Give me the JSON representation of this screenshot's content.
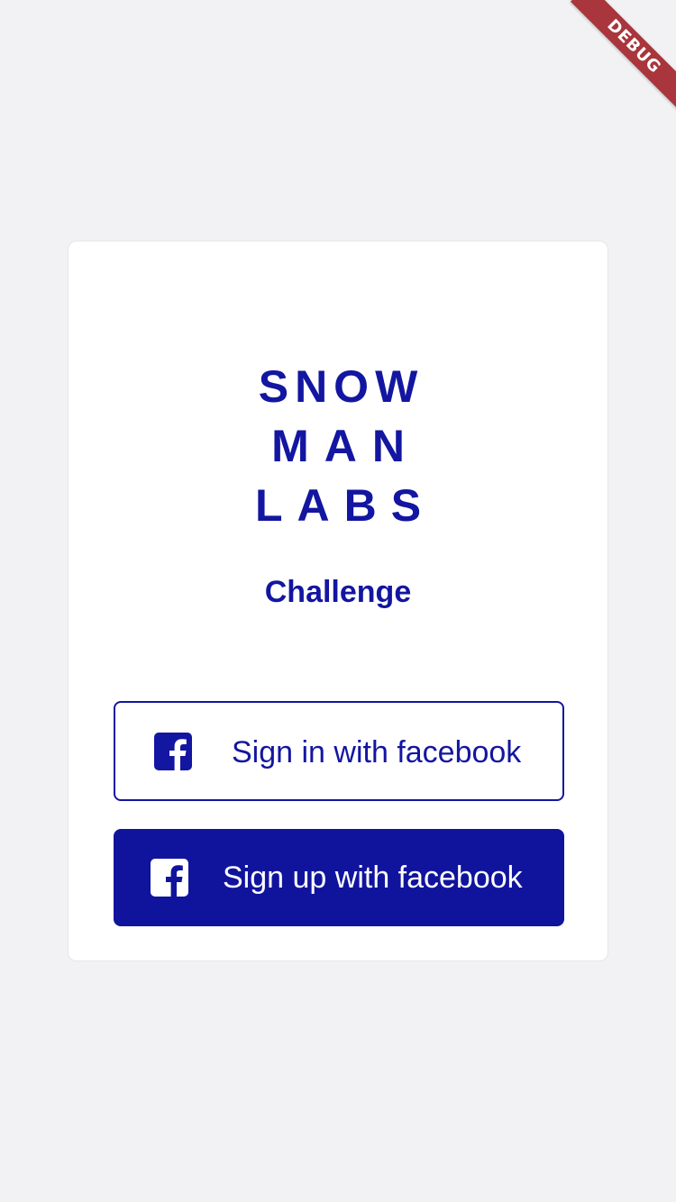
{
  "debug_banner": {
    "label": "DEBUG"
  },
  "logo": {
    "line1": "SNOW",
    "line2": "MAN",
    "line3": "LABS"
  },
  "subtitle": "Challenge",
  "buttons": {
    "sign_in": {
      "label": "Sign in with facebook",
      "icon": "facebook-icon"
    },
    "sign_up": {
      "label": "Sign up with facebook",
      "icon": "facebook-icon"
    }
  },
  "colors": {
    "brand": "#1316a0",
    "background": "#f2f2f4",
    "card": "#ffffff",
    "debug_banner": "#a8363c"
  }
}
